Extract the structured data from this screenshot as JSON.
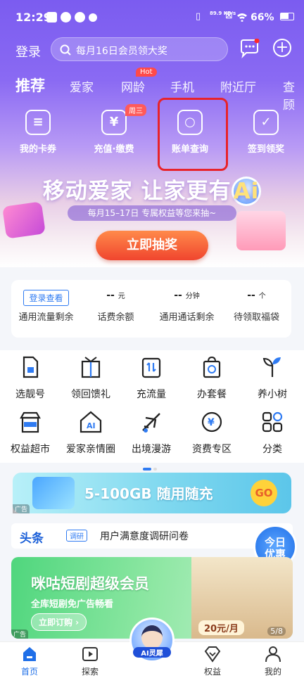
{
  "status_bar": {
    "time": "12:29",
    "speed": "89.9 KB/s",
    "battery": "66%"
  },
  "header": {
    "login": "登录",
    "search_placeholder": "每月16日会员领大奖"
  },
  "tabs": [
    {
      "label": "推荐"
    },
    {
      "label": "爱家"
    },
    {
      "label": "网龄"
    },
    {
      "label": "手机"
    },
    {
      "label": "附近厅"
    },
    {
      "label": "查顾"
    }
  ],
  "hot_badge": "Hot",
  "quick_actions": [
    {
      "label": "我的卡券",
      "icon": "coupon-icon"
    },
    {
      "label": "充值·缴费",
      "icon": "yen-icon"
    },
    {
      "label": "账单查询",
      "icon": "bill-search-icon"
    },
    {
      "label": "签到领奖",
      "icon": "calendar-check-icon"
    }
  ],
  "week_badge": "周三",
  "banner": {
    "title_a": "移动爱家 让家更有",
    "title_ai": "Ai",
    "subtitle": "每月15–17日 专属权益等您来抽~",
    "button": "立即抽奖"
  },
  "stats": [
    {
      "value": "登录查看",
      "unit": "",
      "label": "通用流量剩余"
    },
    {
      "value": "--",
      "unit": "元",
      "label": "话费余额"
    },
    {
      "value": "--",
      "unit": "分钟",
      "label": "通用通话剩余"
    },
    {
      "value": "--",
      "unit": "个",
      "label": "待领取福袋"
    }
  ],
  "grid": [
    {
      "label": "选靓号",
      "icon": "sim-icon"
    },
    {
      "label": "领回馈礼",
      "icon": "gift-icon"
    },
    {
      "label": "充流量",
      "icon": "data-recharge-icon"
    },
    {
      "label": "办套餐",
      "icon": "package-bag-icon"
    },
    {
      "label": "养小树",
      "icon": "sprout-icon"
    },
    {
      "label": "权益超市",
      "icon": "store-icon"
    },
    {
      "label": "爱家亲情圈",
      "icon": "family-home-icon"
    },
    {
      "label": "出境漫游",
      "icon": "airplane-icon"
    },
    {
      "label": "资费专区",
      "icon": "tariff-icon"
    },
    {
      "label": "分类",
      "icon": "category-icon"
    }
  ],
  "promo": {
    "text": "5-100GB 随用随充",
    "go": "GO",
    "ad": "广告"
  },
  "news": {
    "head": "头条",
    "tag": "调研",
    "text": "用户满意度调研问卷"
  },
  "today": {
    "line1": "今日",
    "line2": "优惠"
  },
  "vip": {
    "title": "咪咕短剧超级会员",
    "subtitle": "全库短剧免广告畅看",
    "button": "立即订购 ›",
    "price": "20元/月",
    "page": "5/8",
    "ad": "广告"
  },
  "ai_label": "AI灵犀",
  "nav": [
    {
      "label": "首页"
    },
    {
      "label": "探索"
    },
    {
      "label": "权益"
    },
    {
      "label": "我的"
    }
  ]
}
